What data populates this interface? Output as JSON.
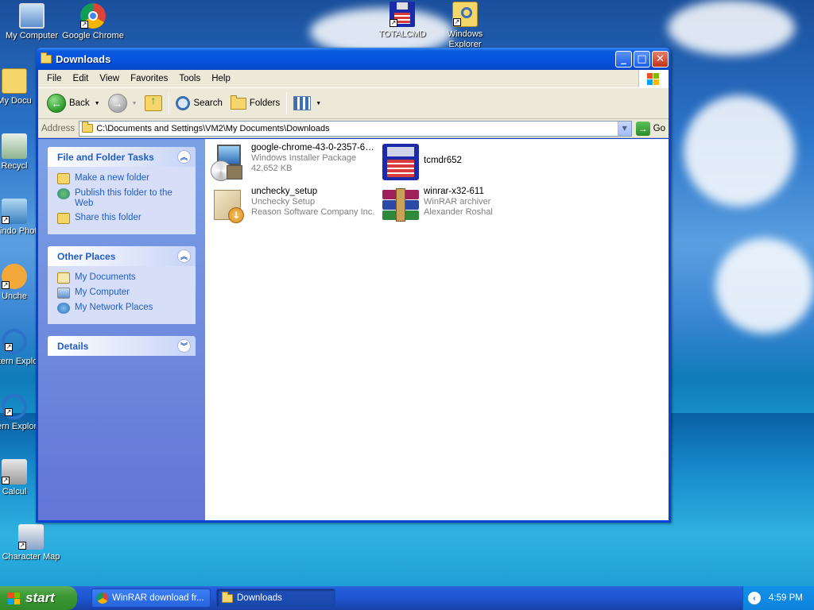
{
  "desktop": {
    "icons": [
      {
        "label": "My Computer"
      },
      {
        "label": "Google Chrome"
      },
      {
        "label": "TOTALCMD"
      },
      {
        "label": "Windows Explorer"
      },
      {
        "label": "My Docu"
      },
      {
        "label": "Recycl"
      },
      {
        "label": "Windo Phot"
      },
      {
        "label": "Unche"
      },
      {
        "label": "Intern Explo"
      },
      {
        "label": "Intern Explore"
      },
      {
        "label": "Calcul"
      },
      {
        "label": "Character Map"
      }
    ]
  },
  "window": {
    "title": "Downloads",
    "menu": [
      "File",
      "Edit",
      "View",
      "Favorites",
      "Tools",
      "Help"
    ],
    "toolbar": {
      "back": "Back",
      "search": "Search",
      "folders": "Folders"
    },
    "address": {
      "label": "Address",
      "value": "C:\\Documents and Settings\\VM2\\My Documents\\Downloads",
      "go": "Go"
    },
    "taskpane": {
      "file_tasks": {
        "title": "File and Folder Tasks",
        "items": [
          "Make a new folder",
          "Publish this folder to the Web",
          "Share this folder"
        ]
      },
      "other_places": {
        "title": "Other Places",
        "items": [
          "My Documents",
          "My Computer",
          "My Network Places"
        ]
      },
      "details": {
        "title": "Details"
      }
    },
    "files": [
      {
        "name": "google-chrome-43-0-2357-65-...",
        "line2": "Windows Installer Package",
        "line3": "42,652 KB"
      },
      {
        "name": "tcmdr652",
        "line2": "",
        "line3": ""
      },
      {
        "name": "unchecky_setup",
        "line2": "Unchecky Setup",
        "line3": "Reason Software Company Inc."
      },
      {
        "name": "winrar-x32-611",
        "line2": "WinRAR archiver",
        "line3": "Alexander Roshal"
      }
    ]
  },
  "taskbar": {
    "start": "start",
    "tasks": [
      "WinRAR download fr...",
      "Downloads"
    ],
    "clock": "4:59 PM"
  },
  "colors": {
    "title_blue": "#0753e0",
    "task_link": "#215dc6",
    "start_green": "#3c9a34"
  }
}
